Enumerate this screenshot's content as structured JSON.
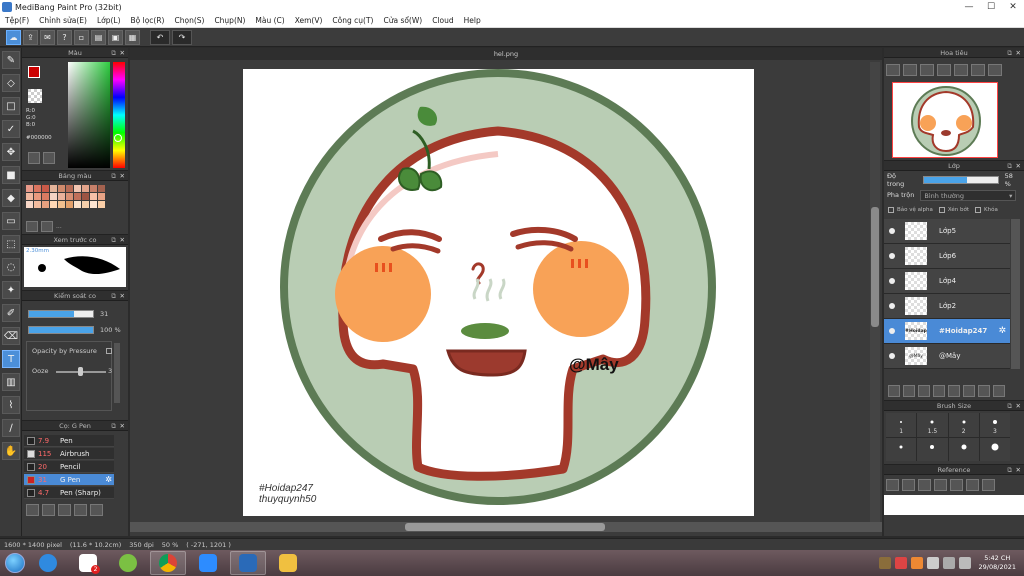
{
  "window": {
    "title": "MediBang Paint Pro (32bit)",
    "minimize": "—",
    "maximize": "☐",
    "close": "✕"
  },
  "menu": [
    "Tệp(F)",
    "Chỉnh sửa(E)",
    "Lớp(L)",
    "Bộ lọc(R)",
    "Chọn(S)",
    "Chụp(N)",
    "Màu (C)",
    "Xem(V)",
    "Công cụ(T)",
    "Cửa sổ(W)",
    "Cloud",
    "Help"
  ],
  "color_panel": {
    "title": "Màu",
    "rgb": [
      "R:0",
      "G:0",
      "B:0"
    ],
    "hex": "#000000",
    "fg": "#cc0000",
    "bg": "#000000"
  },
  "palette_panel": {
    "title": "Bảng màu",
    "more": "...",
    "colors": [
      "#e89a8a",
      "#d9745f",
      "#c85a48",
      "#e4b49a",
      "#cf8a6c",
      "#b66b55",
      "#f2c6b2",
      "#e2a48b",
      "#c7806a",
      "#a4624f",
      "#f0b8a0",
      "#e8997e",
      "#d97b62",
      "#f5d3c3",
      "#eab29b",
      "#d88f73",
      "#c0705a",
      "#9c5443",
      "#f6c0a8",
      "#e9a385",
      "#f8d7c8",
      "#f3bb9e",
      "#e8a07f",
      "#ffd8b5",
      "#f2c08f",
      "#e3a06a",
      "#fce3cc",
      "#f6cfaa",
      "#ffe6d2",
      "#fbcfa8"
    ]
  },
  "preview_panel": {
    "title": "Xem trước co",
    "size_label": "2.30mm"
  },
  "control_panel": {
    "title": "Kiểm soát co",
    "size_value": "31",
    "size_fraction": 0.7,
    "opacity_value": "100 %",
    "opacity_fraction": 1.0,
    "pressure_label": "Opacity by Pressure",
    "ooze_label": "Ooze",
    "ooze_value": "3"
  },
  "brush_panel": {
    "title": "Cọ: G Pen",
    "items": [
      {
        "size": "7.9",
        "name": "Pen",
        "swatch": "#222222",
        "active": false
      },
      {
        "size": "115",
        "name": "Airbrush",
        "swatch": "#dddddd",
        "active": false
      },
      {
        "size": "20",
        "name": "Pencil",
        "swatch": "#222222",
        "active": false
      },
      {
        "size": "31",
        "name": "G Pen",
        "swatch": "#cc2222",
        "active": true
      },
      {
        "size": "4.7",
        "name": "Pen (Sharp)",
        "swatch": "#222222",
        "active": false
      }
    ]
  },
  "canvas": {
    "file_name": "hel.png",
    "signature": "@Mây",
    "watermark_1": "#Hoidap247",
    "watermark_2": "thuyquynh50"
  },
  "navigator": {
    "title": "Hoa tiêu"
  },
  "layer_panel": {
    "title": "Lớp",
    "opacity_label": "Độ trong",
    "opacity_value": "58 %",
    "opacity_fraction": 0.58,
    "blend_label": "Pha trộn",
    "blend_value": "Bình thường",
    "protect_alpha": "Bảo vệ alpha",
    "clipping": "Xén bớt",
    "lock": "Khóa",
    "layers": [
      {
        "name": "Lớp5",
        "thumb": "",
        "active": false
      },
      {
        "name": "Lớp6",
        "thumb": "",
        "active": false
      },
      {
        "name": "Lớp4",
        "thumb": "",
        "active": false
      },
      {
        "name": "Lớp2",
        "thumb": "",
        "active": false
      },
      {
        "name": "#Hoidap247",
        "thumb": "#Hoidap",
        "active": true
      },
      {
        "name": "@Mây",
        "thumb": "@Mây",
        "active": false
      }
    ]
  },
  "brush_size_panel": {
    "title": "Brush Size",
    "sizes": [
      {
        "label": "1",
        "dot": 2
      },
      {
        "label": "1.5",
        "dot": 3
      },
      {
        "label": "2",
        "dot": 3
      },
      {
        "label": "3",
        "dot": 4
      },
      {
        "label": "",
        "dot": 3
      },
      {
        "label": "",
        "dot": 4
      },
      {
        "label": "",
        "dot": 5
      },
      {
        "label": "",
        "dot": 7
      }
    ]
  },
  "reference_panel": {
    "title": "Reference"
  },
  "status": {
    "size": "1600 * 1400 pixel",
    "cm": "(11.6 * 10.2cm)",
    "dpi": "350 dpi",
    "zoom": "50 %",
    "coords": "( -271, 1201 )"
  },
  "taskbar": {
    "time": "5:42 CH",
    "date": "29/08/2021",
    "zalo_badge": "2"
  }
}
